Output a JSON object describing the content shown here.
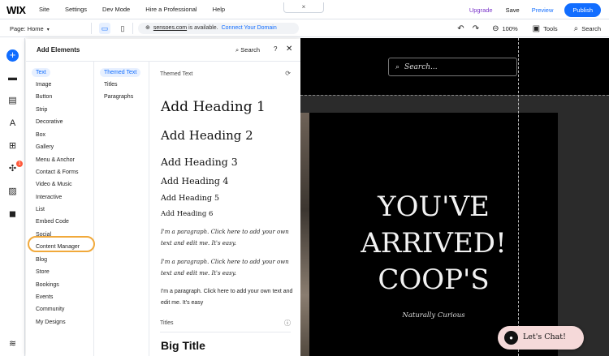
{
  "topbar": {
    "logo": "WIX",
    "menu": [
      "Site",
      "Settings",
      "Dev Mode",
      "Hire a Professional",
      "Help"
    ],
    "domain_chip_icon": "×",
    "upgrade": "Upgrade",
    "save": "Save",
    "preview": "Preview",
    "publish": "Publish"
  },
  "subbar": {
    "page_label": "Page: Home",
    "url_domain": "sensoes.com",
    "url_available": " is available.",
    "url_connect": "Connect Your Domain",
    "zoom": "100%",
    "tools": "Tools",
    "search": "Search"
  },
  "rail": {
    "badge": "1",
    "icons": [
      "add-icon",
      "sections-icon",
      "pages-icon",
      "theme-icon",
      "apps-icon",
      "app-market-icon",
      "media-icon",
      "business-icon",
      "layers-icon"
    ]
  },
  "panel": {
    "title": "Add Elements",
    "search": "Search",
    "help": "?",
    "close": "✕",
    "categories": [
      "Text",
      "Image",
      "Button",
      "Strip",
      "Decorative",
      "Box",
      "Gallery",
      "Menu & Anchor",
      "Contact & Forms",
      "Video & Music",
      "Interactive",
      "List",
      "Embed Code",
      "Social",
      "Content Manager",
      "Blog",
      "Store",
      "Bookings",
      "Events",
      "Community",
      "My Designs"
    ],
    "subcategories": [
      "Themed Text",
      "Titles",
      "Paragraphs"
    ],
    "content": {
      "section_themed": "Themed Text",
      "heading1": "Add Heading 1",
      "heading2": "Add Heading 2",
      "heading3": "Add Heading 3",
      "heading4": "Add Heading 4",
      "heading5": "Add Heading 5",
      "heading6": "Add Heading 6",
      "paragraph1": "I'm a paragraph. Click here to add your own text and edit me. It's easy.",
      "paragraph2": "I'm a paragraph. Click here to add your own text and edit me. It's easy.",
      "paragraph3": "I'm a paragraph. Click here to add your own text and edit me. It's easy",
      "section_titles": "Titles",
      "big_title": "Big Title"
    }
  },
  "site": {
    "search_placeholder": "Search...",
    "hero_line1": "YOU'VE",
    "hero_line2": "ARRIVED!",
    "hero_line3": "COOP'S",
    "tagline": "Naturally Curious",
    "chat_label": "Let's Chat!"
  },
  "colors": {
    "accent": "#116dff",
    "upgrade": "#7a35c9",
    "highlight_ring": "#f1a93b",
    "chat_bg": "#f5d9d9"
  }
}
